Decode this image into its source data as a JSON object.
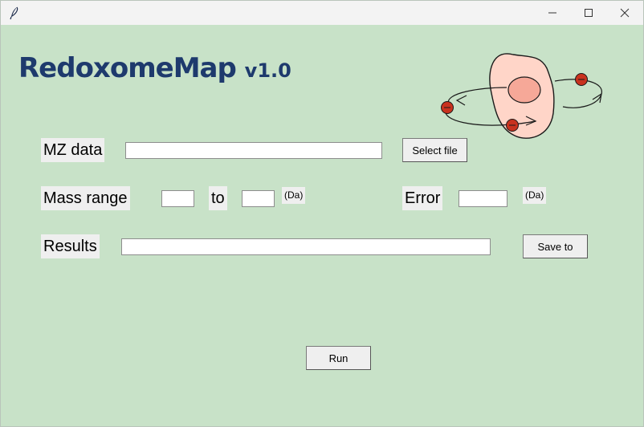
{
  "window": {
    "controls": {
      "minimize_icon": "minimize-icon",
      "maximize_icon": "maximize-icon",
      "close_icon": "close-icon"
    }
  },
  "header": {
    "title": "RedoxomeMap",
    "version": "v1.0",
    "title_color": "#1e3a6d"
  },
  "form": {
    "mz_label": "MZ data",
    "mz_value": "",
    "select_file_label": "Select file",
    "mass_range_label": "Mass range",
    "mass_from_value": "",
    "to_label": "to",
    "mass_to_value": "",
    "mass_unit_label": "(Da)",
    "error_label": "Error",
    "error_value": "",
    "error_unit_label": "(Da)",
    "results_label": "Results",
    "results_value": "",
    "save_to_label": "Save to",
    "run_label": "Run"
  },
  "colors": {
    "background": "#c8e2c8",
    "label_bg": "#efefef",
    "cell_fill": "#ffd5c8",
    "nucleus_fill": "#f6a898",
    "particle_fill": "#c8321e"
  }
}
